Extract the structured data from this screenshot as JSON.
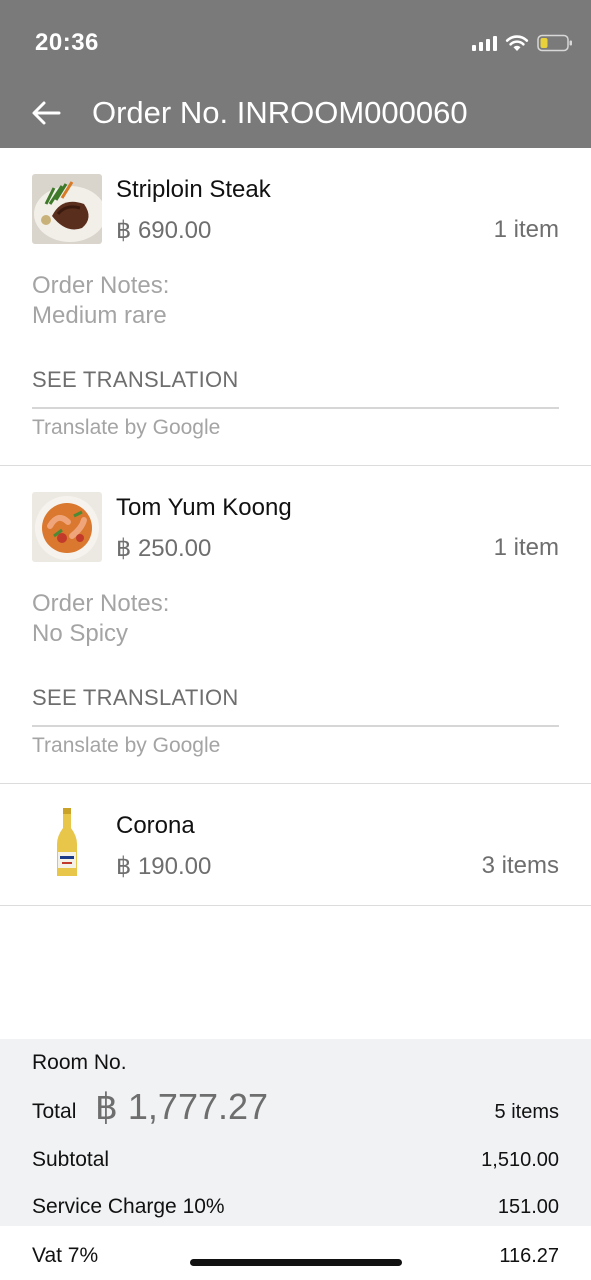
{
  "status_bar": {
    "time": "20:36",
    "icons": [
      "signal-icon",
      "wifi-icon",
      "battery-icon"
    ],
    "battery_color": "#e8d13b"
  },
  "header": {
    "back_icon": "arrow-left-icon",
    "title": "Order No. INROOM000060",
    "background": "#7a7a7a"
  },
  "items": [
    {
      "name": "Striploin Steak",
      "price": "฿ 690.00",
      "qty": "1 item",
      "notes_label": "Order Notes:",
      "notes": "Medium rare",
      "see_translation": "SEE TRANSLATION",
      "translate_by": "Translate by Google"
    },
    {
      "name": "Tom Yum Koong",
      "price": "฿ 250.00",
      "qty": "1 item",
      "notes_label": "Order Notes:",
      "notes": "No Spicy",
      "see_translation": "SEE TRANSLATION",
      "translate_by": "Translate by Google"
    },
    {
      "name": "Corona",
      "price": "฿ 190.00",
      "qty": "3 items"
    }
  ],
  "summary": {
    "room_label": "Room No.",
    "total_label": "Total",
    "total_amount": "฿ 1,777.27",
    "total_items": "5 items",
    "subtotal_label": "Subtotal",
    "subtotal_value": "1,510.00",
    "service_label": "Service Charge 10%",
    "service_value": "151.00",
    "vat_label": "Vat 7%",
    "vat_value": "116.27"
  }
}
